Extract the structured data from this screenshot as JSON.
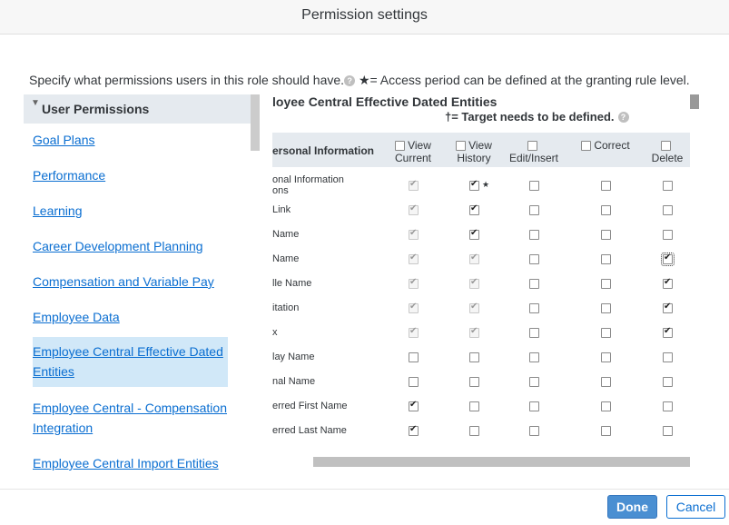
{
  "dialog": {
    "title": "Permission settings"
  },
  "intro": {
    "text": "Specify what permissions users in this role should have.",
    "access_note": "★= Access period can be defined at the granting rule level."
  },
  "left_nav": {
    "header": "User Permissions",
    "items": [
      {
        "label": "Goal Plans"
      },
      {
        "label": "Performance"
      },
      {
        "label": "Learning"
      },
      {
        "label": "Career Development Planning"
      },
      {
        "label": "Compensation and Variable Pay"
      },
      {
        "label": "Employee Data"
      },
      {
        "label": "Employee Central Effective Dated Entities",
        "selected": true
      },
      {
        "label": "Employee Central - Compensation Integration"
      },
      {
        "label": "Employee Central Import Entities"
      }
    ]
  },
  "section": {
    "title": "loyee Central Effective Dated Entities",
    "target_note": "†= Target needs to be defined."
  },
  "table": {
    "first_header": "ersonal Information",
    "columns": [
      {
        "label_1": "View",
        "label_2": "Current"
      },
      {
        "label_1": "View",
        "label_2": "History"
      },
      {
        "label_1": "",
        "label_2": "Edit/Insert"
      },
      {
        "label_1": "Correct",
        "label_2": ""
      },
      {
        "label_1": "",
        "label_2": "Delete"
      }
    ],
    "rows": [
      {
        "name_1": "onal Information",
        "name_2": "ons",
        "star": "★",
        "vc": [
          true,
          true
        ],
        "vh": [
          true,
          false
        ],
        "ei": [
          false,
          false
        ],
        "co": [
          false,
          false
        ],
        "de": [
          false,
          false
        ]
      },
      {
        "name_1": "Link",
        "name_2": "",
        "vc": [
          true,
          true
        ],
        "vh": [
          true,
          false
        ],
        "ei": [
          false,
          false
        ],
        "co": [
          false,
          false
        ],
        "de": [
          false,
          false
        ]
      },
      {
        "name_1": "Name",
        "name_2": "",
        "vc": [
          true,
          true
        ],
        "vh": [
          true,
          false
        ],
        "ei": [
          false,
          false
        ],
        "co": [
          false,
          false
        ],
        "de": [
          false,
          false
        ]
      },
      {
        "name_1": "Name",
        "name_2": "",
        "vc": [
          true,
          true
        ],
        "vh": [
          true,
          true
        ],
        "ei": [
          false,
          false
        ],
        "co": [
          false,
          false
        ],
        "de": [
          true,
          false
        ]
      },
      {
        "name_1": "lle Name",
        "name_2": "",
        "vc": [
          true,
          true
        ],
        "vh": [
          true,
          true
        ],
        "ei": [
          false,
          false
        ],
        "co": [
          false,
          false
        ],
        "de": [
          true,
          false
        ]
      },
      {
        "name_1": "itation",
        "name_2": "",
        "vc": [
          true,
          true
        ],
        "vh": [
          true,
          true
        ],
        "ei": [
          false,
          false
        ],
        "co": [
          false,
          false
        ],
        "de": [
          true,
          false
        ]
      },
      {
        "name_1": "x",
        "name_2": "",
        "vc": [
          true,
          true
        ],
        "vh": [
          true,
          true
        ],
        "ei": [
          false,
          false
        ],
        "co": [
          false,
          false
        ],
        "de": [
          true,
          false
        ]
      },
      {
        "name_1": "lay Name",
        "name_2": "",
        "vc": [
          false,
          false
        ],
        "vh": [
          false,
          false
        ],
        "ei": [
          false,
          false
        ],
        "co": [
          false,
          false
        ],
        "de": [
          false,
          false
        ]
      },
      {
        "name_1": "nal Name",
        "name_2": "",
        "vc": [
          false,
          false
        ],
        "vh": [
          false,
          false
        ],
        "ei": [
          false,
          false
        ],
        "co": [
          false,
          false
        ],
        "de": [
          false,
          false
        ]
      },
      {
        "name_1": "erred First Name",
        "name_2": "",
        "vc": [
          true,
          false
        ],
        "vh": [
          false,
          false
        ],
        "ei": [
          false,
          false
        ],
        "co": [
          false,
          false
        ],
        "de": [
          false,
          false
        ]
      },
      {
        "name_1": "erred Last Name",
        "name_2": "",
        "vc": [
          true,
          false
        ],
        "vh": [
          false,
          false
        ],
        "ei": [
          false,
          false
        ],
        "co": [
          false,
          false
        ],
        "de": [
          false,
          false
        ]
      }
    ]
  },
  "footer": {
    "done_label": "Done",
    "cancel_label": "Cancel"
  },
  "colors": {
    "accent": "#0a6ed1",
    "header_bg": "#e5eaef",
    "selected_bg": "#d1e8f8",
    "done_bg": "#4a8fd2"
  }
}
